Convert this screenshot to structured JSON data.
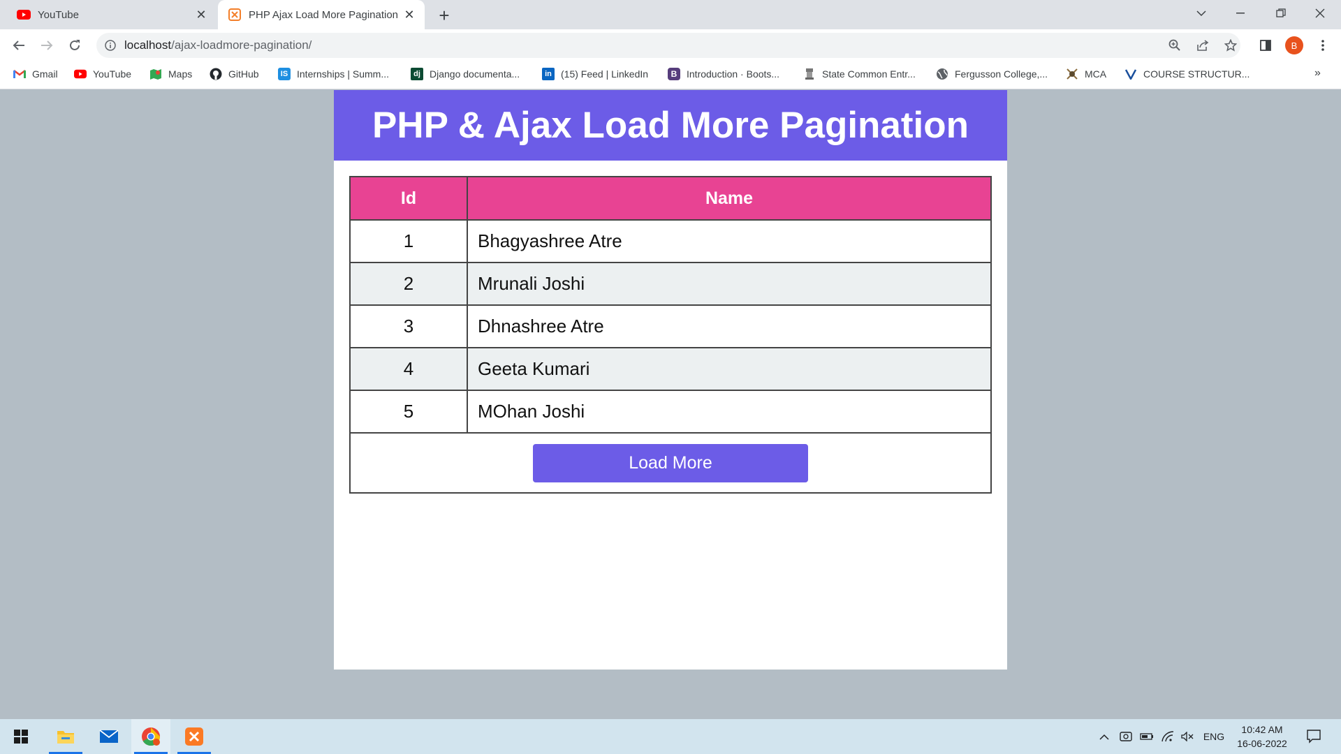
{
  "browser": {
    "tabs": [
      {
        "title": "YouTube",
        "favicon": "youtube-icon"
      },
      {
        "title": "PHP Ajax Load More Pagination",
        "favicon": "xampp-icon"
      }
    ],
    "url": {
      "host": "localhost",
      "path": "/ajax-loadmore-pagination/"
    },
    "profile_initial": "B",
    "bookmarks": [
      {
        "label": "Gmail",
        "icon": "gmail-icon"
      },
      {
        "label": "YouTube",
        "icon": "youtube-icon"
      },
      {
        "label": "Maps",
        "icon": "maps-icon"
      },
      {
        "label": "GitHub",
        "icon": "github-icon"
      },
      {
        "label": "Internships | Summ...",
        "icon": "internshala-icon"
      },
      {
        "label": "Django documenta...",
        "icon": "django-icon"
      },
      {
        "label": "(15) Feed | LinkedIn",
        "icon": "linkedin-icon"
      },
      {
        "label": "Introduction · Boots...",
        "icon": "bootstrap-icon"
      },
      {
        "label": "State Common Entr...",
        "icon": "emblem-icon"
      },
      {
        "label": "Fergusson College,...",
        "icon": "globe-icon"
      },
      {
        "label": "MCA",
        "icon": "crest-icon"
      },
      {
        "label": "COURSE STRUCTUR...",
        "icon": "v-logo-icon"
      }
    ],
    "bookmarks_more": "»"
  },
  "page": {
    "title": "PHP & Ajax Load More Pagination",
    "table": {
      "headers": [
        "Id",
        "Name"
      ],
      "rows": [
        {
          "id": "1",
          "name": "Bhagyashree Atre"
        },
        {
          "id": "2",
          "name": "Mrunali Joshi"
        },
        {
          "id": "3",
          "name": "Dhnashree Atre"
        },
        {
          "id": "4",
          "name": "Geeta Kumari"
        },
        {
          "id": "5",
          "name": "MOhan Joshi"
        }
      ]
    },
    "load_more_label": "Load More"
  },
  "colors": {
    "header_bg": "#6c5ce7",
    "table_header_bg": "#e84393",
    "button_bg": "#6c5ce7",
    "alt_row_bg": "#ecf0f1"
  },
  "taskbar": {
    "apps": [
      "windows-start-icon",
      "file-explorer-icon",
      "mail-icon",
      "chrome-icon",
      "xampp-icon"
    ],
    "language": "ENG",
    "time": "10:42 AM",
    "date": "16-06-2022"
  }
}
